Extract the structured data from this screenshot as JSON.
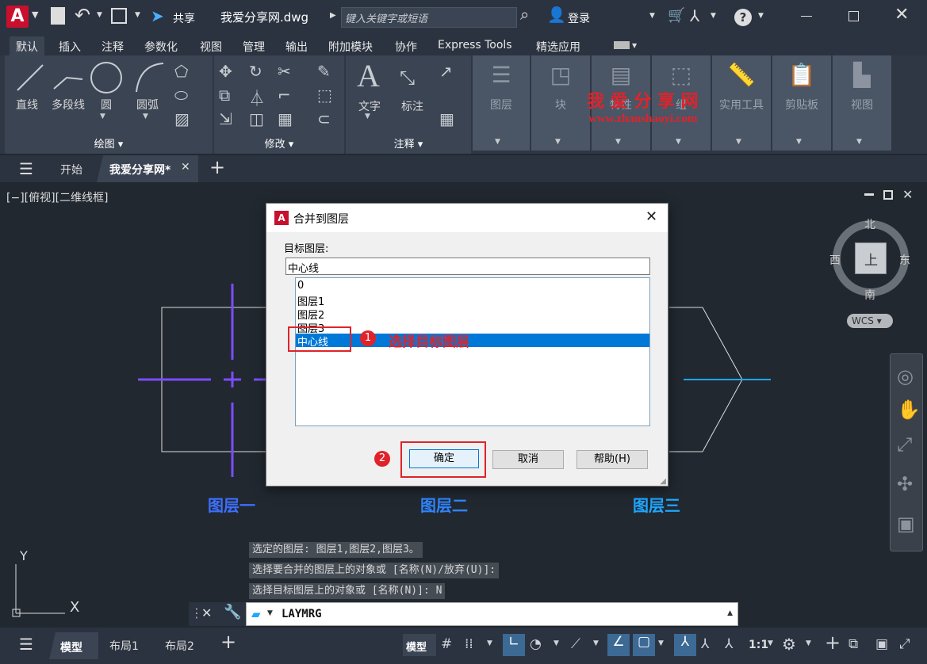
{
  "app": {
    "file_title": "我爱分享网.dwg",
    "share_label": "共享",
    "search_placeholder": "键入关键字或短语",
    "login_label": "登录"
  },
  "menu_tabs": [
    "默认",
    "插入",
    "注释",
    "参数化",
    "视图",
    "管理",
    "输出",
    "附加模块",
    "协作",
    "Express Tools",
    "精选应用"
  ],
  "ribbon": {
    "draw": {
      "tools": [
        "直线",
        "多段线",
        "圆",
        "圆弧"
      ],
      "panel_label": "绘图 ▾"
    },
    "modify": {
      "panel_label": "修改 ▾"
    },
    "annotate": {
      "tools": [
        "文字",
        "标注"
      ],
      "panel_label": "注释 ▾"
    },
    "grey_panels": [
      "图层",
      "块",
      "特性",
      "组",
      "实用工具",
      "剪贴板",
      "视图"
    ]
  },
  "watermark": {
    "title": "我 爱 分 享 网",
    "url": "www.zhanshaoyi.com"
  },
  "doc_tabs": {
    "start": "开始",
    "current": "我爱分享网*"
  },
  "viewport": {
    "label": "[−][俯视][二维线框]"
  },
  "viewcube": {
    "north": "北",
    "south": "南",
    "east": "东",
    "west": "西",
    "top": "上",
    "wcs": "WCS"
  },
  "layers_labels": [
    "图层一",
    "图层二",
    "图层三"
  ],
  "dialog": {
    "title": "合并到图层",
    "target_label": "目标图层:",
    "target_value": "中心线",
    "list": [
      "0",
      "图层1",
      "图层2",
      "图层3",
      "中心线"
    ],
    "selected_index": 4,
    "ok": "确定",
    "cancel": "取消",
    "help": "帮助(H)"
  },
  "annotations": {
    "step1": "1",
    "step1_text": "选择目标图层",
    "step2": "2"
  },
  "command_history": [
    "选定的图层: 图层1,图层2,图层3。",
    "选择要合并的图层上的对象或 [名称(N)/放弃(U)]:",
    "选择目标图层上的对象或 [名称(N)]: N"
  ],
  "command_input": "LAYMRG",
  "ucs": {
    "y": "Y",
    "x": "X"
  },
  "status": {
    "model_tab": "模型",
    "layout1": "布局1",
    "layout2": "布局2",
    "model_btn": "模型",
    "scale": "1:1"
  },
  "colors": {
    "accent_red": "#e0232a",
    "selected_blue": "#0078d7",
    "purple_line": "#7b4dff",
    "cyan_line": "#1fa6ff",
    "label_blue": "#3d6fff"
  }
}
